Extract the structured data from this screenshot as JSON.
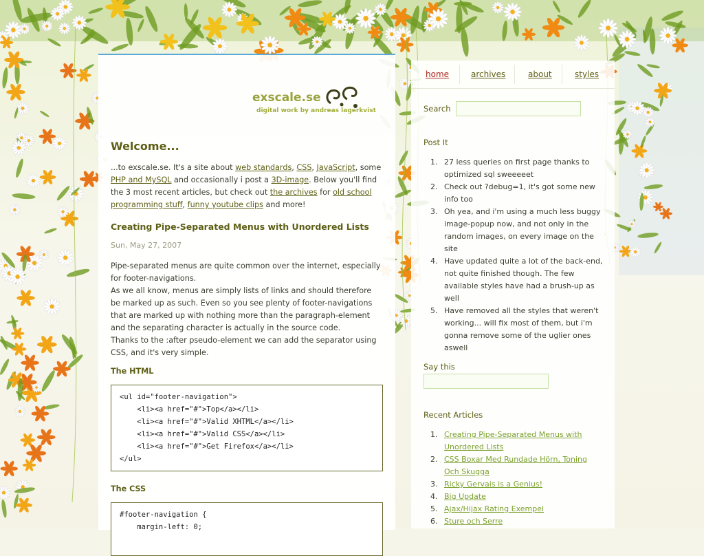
{
  "site": {
    "name": "exscale.se",
    "tagline": "digital work by andreas lagerkvist"
  },
  "main": {
    "welcome_title": "Welcome...",
    "intro": {
      "t1": "...to exscale.se. It's a site about ",
      "l1": "web standards",
      "t2": ", ",
      "l2": "CSS",
      "t3": ", ",
      "l3": "JavaScript",
      "t4": ", some ",
      "l4": "PHP and MySQL",
      "t5": " and occasionally i post a ",
      "l5": "3D-image",
      "t6": ". Below you'll find the 3 most recent articles, but check out ",
      "l6": "the archives",
      "t7": " for ",
      "l7": "old school programming stuff",
      "t8": ", ",
      "l8": "funny youtube clips",
      "t9": " and more!"
    },
    "article": {
      "title": "Creating Pipe-Separated Menus with Unordered Lists",
      "date": "Sun, May 27, 2007",
      "body": "Pipe-separated menus are quite common over the internet, especially for footer-navigations.\nAs we all know, menus are simply lists of links and should therefore be marked up as such. Even so you see plenty of footer-navigations that are marked up with nothing more than the paragraph-element and the separating character is actually in the source code.\nThanks to the :after pseudo-element we can add the separator using CSS, and it's very simple.",
      "html_heading": "The HTML",
      "html_code": "<ul id=\"footer-navigation\">\n    <li><a href=\"#\">Top</a></li>\n    <li><a href=\"#\">Valid XHTML</a></li>\n    <li><a href=\"#\">Valid CSS</a></li>\n    <li><a href=\"#\">Get Firefox</a></li>\n</ul>",
      "css_heading": "The CSS",
      "css_code": "#footer-navigation {\n    margin-left: 0;"
    }
  },
  "nav": {
    "items": [
      {
        "label": "home",
        "active": true
      },
      {
        "label": "archives",
        "active": false
      },
      {
        "label": "about",
        "active": false
      },
      {
        "label": "styles",
        "active": false
      }
    ]
  },
  "sidebar": {
    "search_label": "Search",
    "search_value": "",
    "postit_label": "Post It",
    "postit_items": [
      "27 less queries on first page thanks to optimized sql sweeeeet",
      "Check out ?debug=1, it's got some new info too",
      "Oh yea, and i'm using a much less buggy image-popup now, and not only in the random images, on every image on the site",
      "Have updated quite a lot of the back-end, not quite finished though. The few available styles have had a brush-up as well",
      "Have removed all the styles that weren't working... will fix most of them, but i'm gonna remove some of the uglier ones aswell"
    ],
    "saythis_label": "Say this",
    "saythis_value": "",
    "recent_label": "Recent Articles",
    "recent_items": [
      "Creating Pipe-Separated Menus with Unordered Lists",
      "CSS Boxar Med Rundade Hörn, Toning Och Skugga",
      "Ricky Gervais is a Genius!",
      "Big Update",
      "Ajax/Hijax Rating Exempel",
      "Sture och Serre"
    ]
  },
  "colors": {
    "accent": "#5e5f16",
    "active_nav": "#b0261e",
    "link_green": "#7ca12e",
    "top_border": "#5aa9d6"
  }
}
